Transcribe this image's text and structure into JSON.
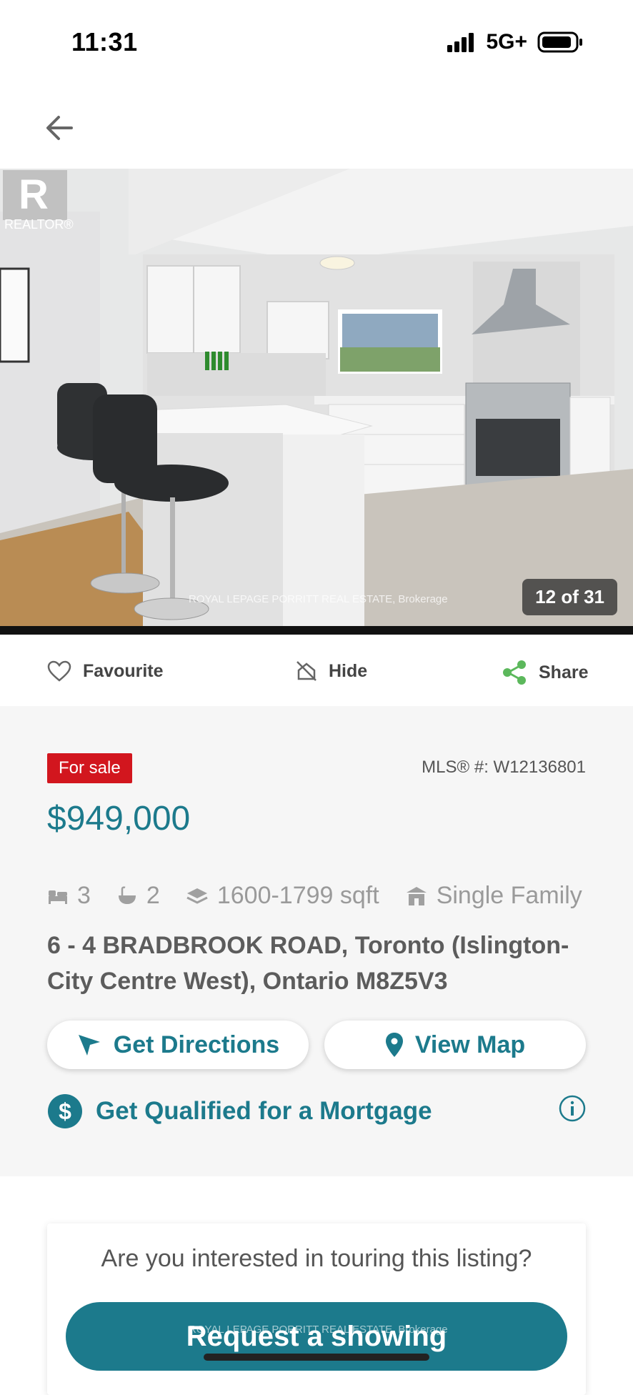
{
  "status": {
    "time": "11:31",
    "network": "5G+"
  },
  "photo": {
    "counter": "12 of 31",
    "realtor_mark": "REALTOR®",
    "watermark": "ROYAL LEPAGE PORRITT REAL ESTATE, Brokerage"
  },
  "actions": {
    "favourite": "Favourite",
    "hide": "Hide",
    "share": "Share"
  },
  "listing": {
    "status_badge": "For sale",
    "mls": "MLS® #: W12136801",
    "price": "$949,000",
    "beds": "3",
    "baths": "2",
    "sqft": "1600-1799 sqft",
    "type": "Single Family",
    "address": "6 - 4 BRADBROOK ROAD, Toronto (Islington-City Centre West), Ontario M8Z5V3"
  },
  "buttons": {
    "directions": "Get Directions",
    "map": "View Map",
    "mortgage": "Get Qualified for a Mortgage"
  },
  "tour": {
    "question": "Are you interested in touring this listing?",
    "request": "Request a showing",
    "watermark": "ROYAL LEPAGE PORRITT REAL ESTATE, Brokerage"
  },
  "colors": {
    "accent": "#1c7a8c",
    "badge": "#d2161e",
    "share": "#5cb85c"
  }
}
